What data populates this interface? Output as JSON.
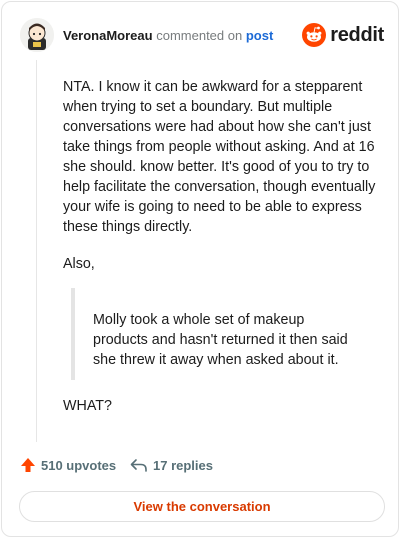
{
  "comment": {
    "author": "VeronaMoreau",
    "commented_text": "commented on",
    "post_link": "post",
    "paragraph_1": "NTA. I know it can be awkward for a stepparent when trying to set a boundary. But multiple conversations were had about how she can't just take things from people without asking. And at 16 she should. know better. It's good of you to try to help facilitate the conversation, though eventually your wife is going to need to be able to express these things directly.",
    "paragraph_2": "Also,",
    "quote": "Molly took a whole set of makeup products and hasn't returned it then said she threw it away when asked about it.",
    "paragraph_3": "WHAT?"
  },
  "brand": {
    "wordmark": "reddit",
    "color": "#ff4500"
  },
  "actions": {
    "upvotes": "510 upvotes",
    "replies": "17 replies",
    "upvote_color": "#ff4500"
  },
  "footer": {
    "view_button": "View the conversation"
  }
}
